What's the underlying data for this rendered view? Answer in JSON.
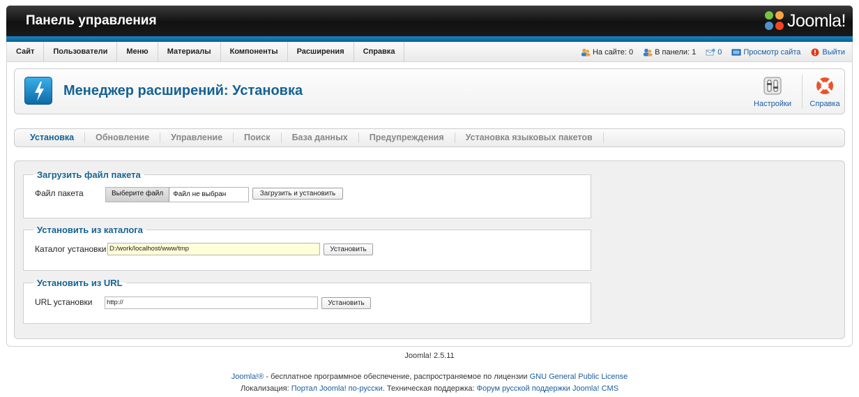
{
  "header": {
    "title": "Панель управления",
    "logo_text": "Joomla!",
    "logo_icon": "joomla-logo"
  },
  "menu": {
    "items": [
      {
        "label": "Сайт"
      },
      {
        "label": "Пользователи"
      },
      {
        "label": "Меню"
      },
      {
        "label": "Материалы"
      },
      {
        "label": "Компоненты"
      },
      {
        "label": "Расширения"
      },
      {
        "label": "Справка"
      }
    ],
    "status": {
      "on_site": "На сайте: 0",
      "in_panel": "В панели: 1",
      "messages": "0",
      "view_site": "Просмотр сайта",
      "logout": "Выйти"
    }
  },
  "titlebar": {
    "title": "Менеджер расширений: Установка",
    "icon": "extension-manager-icon",
    "buttons": {
      "settings": "Настройки",
      "help": "Справка"
    }
  },
  "tabs": [
    {
      "label": "Установка",
      "active": true
    },
    {
      "label": "Обновление"
    },
    {
      "label": "Управление"
    },
    {
      "label": "Поиск"
    },
    {
      "label": "База данных"
    },
    {
      "label": "Предупреждения"
    },
    {
      "label": "Установка языковых пакетов"
    }
  ],
  "upload": {
    "legend": "Загрузить файл пакета",
    "label": "Файл пакета",
    "choose_button": "Выберите файл",
    "no_file": "Файл не выбран",
    "submit": "Загрузить и установить"
  },
  "directory": {
    "legend": "Установить из каталога",
    "label": "Каталог установки",
    "value": "D:/work/localhost/www/tmp",
    "submit": "Установить"
  },
  "url": {
    "legend": "Установить из URL",
    "label": "URL установки",
    "value": "http://",
    "submit": "Установить"
  },
  "footer": {
    "version": "Joomla! 2.5.11",
    "line1_link1": "Joomla!®",
    "line1_text": " - бесплатное программное обеспечение, распространяемое по лицензии ",
    "line1_link2": "GNU General Public License",
    "line2_text1": "Локализация: ",
    "line2_link1": "Портал Joomla! по-русски",
    "line2_text2": ". Техническая поддержка: ",
    "line2_link2": "Форум русской поддержки Joomla! CMS"
  },
  "colors": {
    "accent": "#146295",
    "link": "#1a5da2",
    "header_bg": "#111111",
    "strip": "#0a5d93"
  }
}
